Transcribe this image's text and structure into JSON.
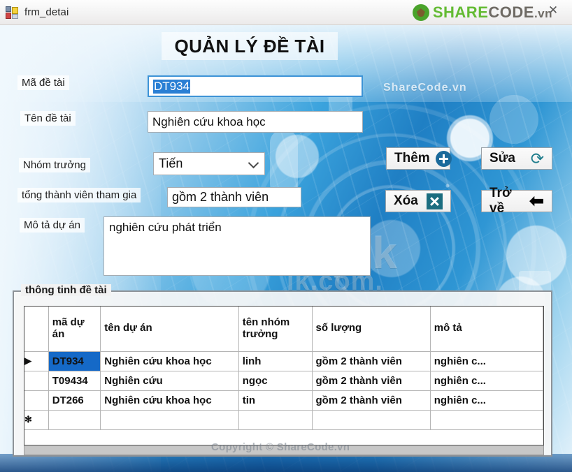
{
  "window": {
    "title": "frm_detai",
    "icon": "form-icon",
    "close_glyph": "✕"
  },
  "branding": {
    "logo_share": "SHARE",
    "logo_code": "CODE",
    "logo_vn": ".vn",
    "watermark_sharecode": "ShareCode.vn",
    "watermark_freepik": "eepik",
    "watermark_freepik2": "ik.com.",
    "copyright": "Copyright © ShareCode.vn"
  },
  "form": {
    "heading": "QUẢN LÝ ĐỀ TÀI",
    "fields": {
      "ma_de_tai": {
        "label": "Mã đề tài",
        "value": "DT934",
        "selected": true
      },
      "ten_de_tai": {
        "label": "Tên đề tài",
        "value": "Nghiên cứu khoa học"
      },
      "nhom_truong": {
        "label": "Nhóm trưởng",
        "value": "Tiến",
        "icon": "chevron-down-icon"
      },
      "tong_thanh_vien": {
        "label": "tổng thành viên tham gia",
        "value": "gồm 2 thành viên"
      },
      "mo_ta_du_an": {
        "label": "Mô tả dự án",
        "value": "nghiên cứu phát triển"
      }
    }
  },
  "buttons": {
    "them": {
      "label": "Thêm",
      "icon": "plus-circle-icon"
    },
    "sua": {
      "label": "Sửa",
      "icon": "refresh-icon",
      "glyph": "⟳"
    },
    "xoa": {
      "label": "Xóa",
      "icon": "close-x-icon"
    },
    "tro_ve": {
      "label": "Trở về",
      "icon": "back-arrow-icon",
      "glyph": "⬅"
    }
  },
  "grid": {
    "group_title": "thông tinh đề tài",
    "columns": [
      "",
      "mã dự án",
      "tên dự án",
      "tên nhóm trưởng",
      "số lượng",
      "mô tả"
    ],
    "rows": [
      {
        "marker": "▶",
        "ma_du_an": "DT934",
        "ten_du_an": "Nghiên cứu khoa học",
        "nhom_truong": "linh",
        "so_luong": "gồm 2 thành viên",
        "mo_ta": "nghiên c...",
        "selected": true
      },
      {
        "marker": "",
        "ma_du_an": "T09434",
        "ten_du_an": "Nghiên cứu",
        "nhom_truong": "ngọc",
        "so_luong": "gồm 2 thành viên",
        "mo_ta": "nghiên c...",
        "selected": false
      },
      {
        "marker": "",
        "ma_du_an": "DT266",
        "ten_du_an": "Nghiên cứu khoa học",
        "nhom_truong": "tin",
        "so_luong": "gồm 2 thành viên",
        "mo_ta": "nghiên c...",
        "selected": false
      },
      {
        "marker": "✻",
        "ma_du_an": "",
        "ten_du_an": "",
        "nhom_truong": "",
        "so_luong": "",
        "mo_ta": "",
        "selected": false
      }
    ]
  },
  "colors": {
    "selection_blue": "#1569C7",
    "focus_border": "#3d93d6",
    "accent_teal": "#1b6d80",
    "accent_blue": "#1b6a9b",
    "logo_green": "#63bb33"
  }
}
